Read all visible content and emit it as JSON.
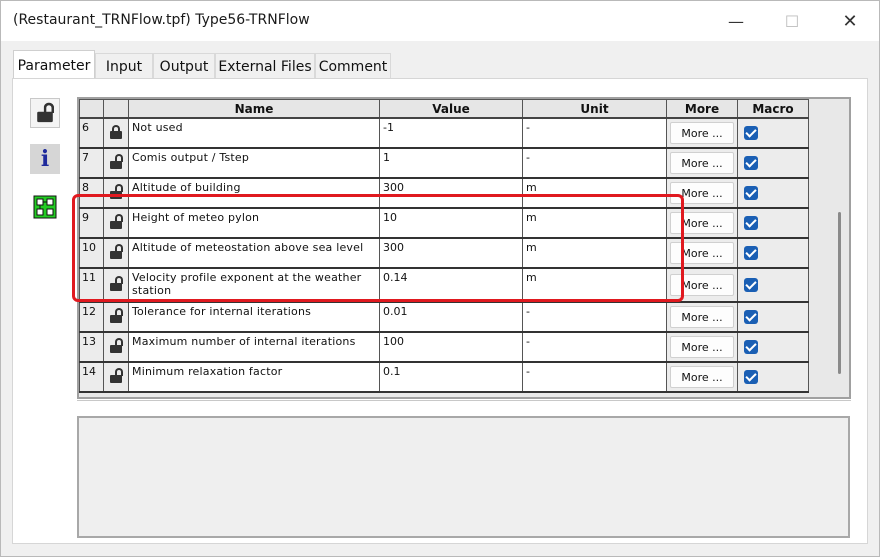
{
  "window": {
    "title": "(Restaurant_TRNFlow.tpf) Type56-TRNFlow"
  },
  "titlebar_buttons": {
    "minimize": "—",
    "maximize": "☐",
    "close": "✕"
  },
  "tabs": [
    {
      "label": "Parameter",
      "active": true
    },
    {
      "label": "Input",
      "active": false
    },
    {
      "label": "Output",
      "active": false
    },
    {
      "label": "External Files",
      "active": false
    },
    {
      "label": "Comment",
      "active": false
    }
  ],
  "side_icons": [
    "unlock-all-icon",
    "info-icon",
    "grid-component-icon"
  ],
  "grid": {
    "columns": [
      "",
      "",
      "Name",
      "Value",
      "Unit",
      "More",
      "Macro"
    ],
    "more_label": "More ...",
    "rows": [
      {
        "index": "6",
        "locked": true,
        "name": "Not used",
        "value": "-1",
        "unit": "-",
        "macro": true
      },
      {
        "index": "7",
        "locked": false,
        "name": "Comis output / Tstep",
        "value": "1",
        "unit": "-",
        "macro": true
      },
      {
        "index": "8",
        "locked": false,
        "name": "Altitude of building",
        "value": "300",
        "unit": "m",
        "macro": true
      },
      {
        "index": "9",
        "locked": false,
        "name": "Height of meteo pylon",
        "value": "10",
        "unit": "m",
        "macro": true
      },
      {
        "index": "10",
        "locked": false,
        "name": "Altitude of meteostation above sea level",
        "value": "300",
        "unit": "m",
        "macro": true
      },
      {
        "index": "11",
        "locked": false,
        "name": "Velocity profile exponent at the weather station",
        "value": "0.14",
        "unit": "m",
        "macro": true
      },
      {
        "index": "12",
        "locked": false,
        "name": "Tolerance for internal iterations",
        "value": "0.01",
        "unit": "-",
        "macro": true
      },
      {
        "index": "13",
        "locked": false,
        "name": "Maximum number of internal iterations",
        "value": "100",
        "unit": "-",
        "macro": true
      },
      {
        "index": "14",
        "locked": false,
        "name": "Minimum relaxation factor",
        "value": "0.1",
        "unit": "-",
        "macro": true
      }
    ]
  },
  "colors": {
    "highlight": "#e0191f",
    "checkbox": "#1a5fb4"
  }
}
